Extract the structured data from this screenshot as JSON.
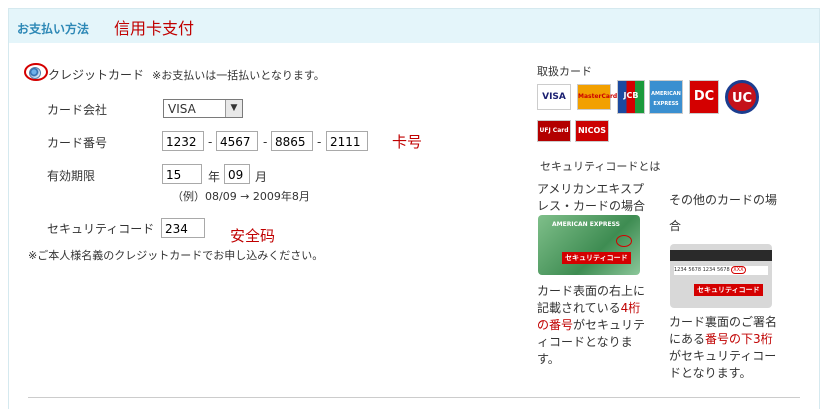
{
  "header": {
    "title": "お支払い方法",
    "annotation": "信用卡支付"
  },
  "payment": {
    "method_label": "クレジットカード",
    "method_note": "※お支払いは一括払いとなります。",
    "company_label": "カード会社",
    "company_value": "VISA",
    "number_label": "カード番号",
    "number_parts": [
      "1232",
      "4567",
      "8865",
      "2111"
    ],
    "number_sep": "-",
    "number_annotation": "卡号",
    "expiry_label": "有効期限",
    "expiry_year": "15",
    "expiry_year_unit": "年",
    "expiry_month": "09",
    "expiry_month_unit": "月",
    "expiry_example": "（例）08/09 → 2009年8月",
    "security_label": "セキュリティコード",
    "security_value": "234",
    "security_annotation": "安全码",
    "owner_note": "※ご本人様名義のクレジットカードでお申し込みください。"
  },
  "side": {
    "cards_title": "取扱カード",
    "card_logos": [
      "VISA",
      "MasterCard",
      "JCB",
      "AMERICAN EXPRESS",
      "DC",
      "UC",
      "UFJ Card",
      "NICOS"
    ],
    "security_title": "セキュリティコードとは",
    "amex": {
      "heading": "アメリカンエキスプレス・カードの場合",
      "card_text": "AMERICAN EXPRESS",
      "card_label": "セキュリティコード",
      "desc_1": "カード表面の右上に記載されている",
      "desc_red": "4桁の番号",
      "desc_2": "がセキュリティコードとなります。"
    },
    "other": {
      "heading": "その他のカードの場合",
      "card_number": "1234 5678 1234 5678",
      "card_code": "XXX",
      "card_label": "セキュリティコード",
      "desc_1": "カード裏面のご署名にある",
      "desc_red": "番号の下3桁",
      "desc_2": "がセキュリティコードとなります。"
    }
  }
}
